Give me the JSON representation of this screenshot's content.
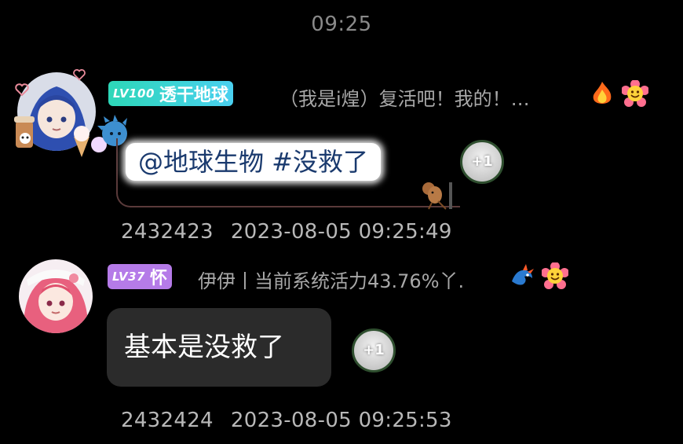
{
  "status_time": "09:25",
  "messages": [
    {
      "level": "LV100",
      "nickname": "透干地球",
      "title_text": "（我是i煌）复活吧！我的！…",
      "content": "@地球生物 #没救了",
      "reaction": "+1",
      "message_id": "2432423",
      "timestamp": "2023-08-05 09:25:49",
      "badge_color": "#3fd6c6",
      "avatar_icon": "blue-hair-anime-avatar",
      "emojis": [
        "fire-icon",
        "smiling-flower-icon"
      ]
    },
    {
      "level": "LV37",
      "nickname": "怀",
      "title_text": "伊伊丨当前系统活力43.76%丫.",
      "content": "基本是没救了",
      "reaction": "+1",
      "message_id": "2432424",
      "timestamp": "2023-08-05 09:25:53",
      "badge_color": "#b57be8",
      "avatar_icon": "pink-hair-anime-avatar",
      "emojis": [
        "dragon-icon",
        "smiling-flower-icon"
      ]
    }
  ]
}
